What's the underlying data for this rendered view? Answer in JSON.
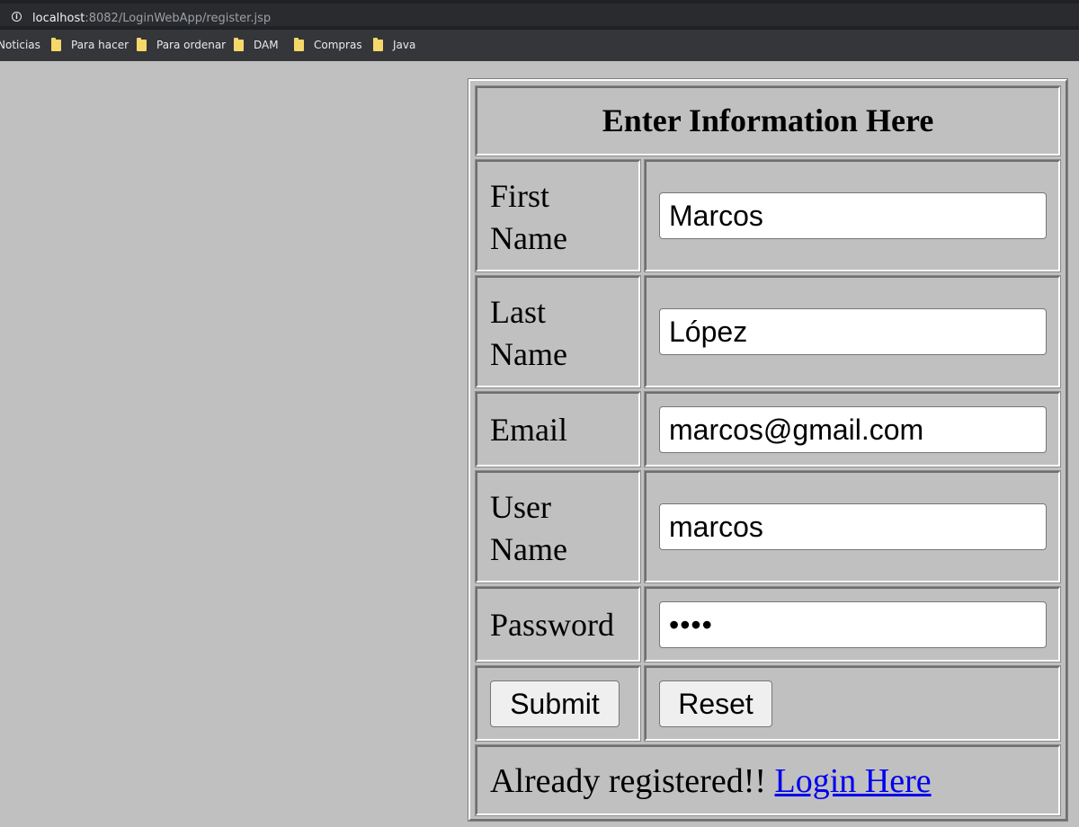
{
  "browser": {
    "url_host": "localhost",
    "url_rest": ":8082/LoginWebApp/register.jsp",
    "info_icon": "info-icon",
    "bookmarks": [
      {
        "label": "Noticias"
      },
      {
        "label": "Para hacer",
        "icon": "folder-icon"
      },
      {
        "label": "Para ordenar",
        "icon": "folder-icon"
      },
      {
        "label": "DAM",
        "icon": "folder-icon"
      },
      {
        "label": "Compras",
        "icon": "folder-icon"
      },
      {
        "label": "Java",
        "icon": "folder-icon"
      }
    ]
  },
  "form": {
    "heading": "Enter Information Here",
    "fields": [
      {
        "label_1": "First",
        "label_2": "Name",
        "value": "Marcos"
      },
      {
        "label_1": "Last",
        "label_2": "Name",
        "value": "López"
      },
      {
        "label_1": "Email",
        "value": "marcos@gmail.com"
      },
      {
        "label_1": "User",
        "label_2": "Name",
        "value": "marcos"
      },
      {
        "label_1": "Password",
        "value": "••••"
      }
    ],
    "submit_label": "Submit",
    "reset_label": "Reset",
    "footer_text": "Already registered!! ",
    "login_link": "Login Here"
  },
  "colors": {
    "page_background": "#c0c0c0",
    "link": "#0000ee"
  }
}
